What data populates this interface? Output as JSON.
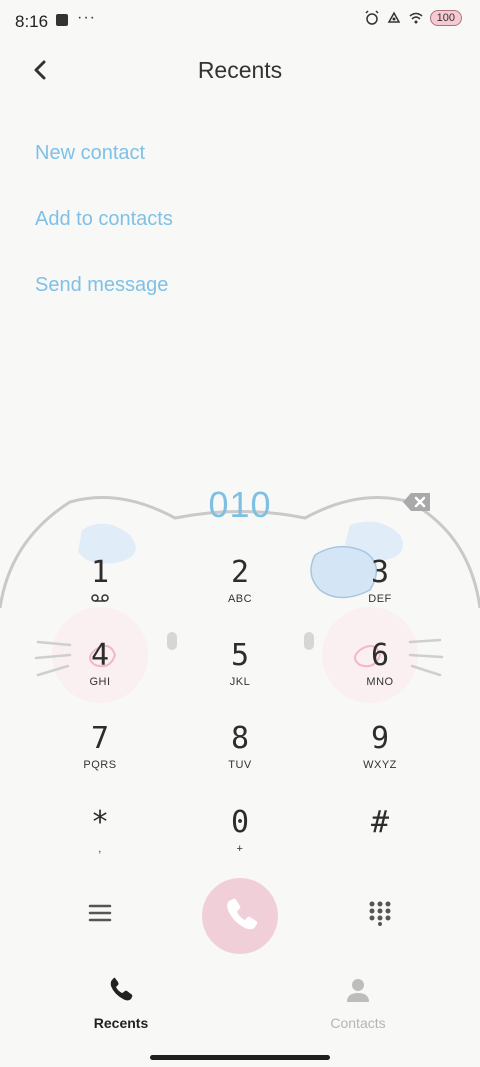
{
  "status_bar": {
    "time": "8:16",
    "overflow": "···",
    "icons": [
      "alarm-icon",
      "settings-icon",
      "wifi-icon"
    ],
    "battery": "100"
  },
  "header": {
    "back_icon": "chevron-left-icon",
    "title": "Recents"
  },
  "menu": {
    "items": [
      {
        "label": "New contact"
      },
      {
        "label": "Add to contacts"
      },
      {
        "label": "Send message"
      }
    ]
  },
  "dialer": {
    "number": "010",
    "keys": [
      {
        "digit": "1",
        "letters": ""
      },
      {
        "digit": "2",
        "letters": "ABC"
      },
      {
        "digit": "3",
        "letters": "DEF"
      },
      {
        "digit": "4",
        "letters": "GHI"
      },
      {
        "digit": "5",
        "letters": "JKL"
      },
      {
        "digit": "6",
        "letters": "MNO"
      },
      {
        "digit": "7",
        "letters": "PQRS"
      },
      {
        "digit": "8",
        "letters": "TUV"
      },
      {
        "digit": "9",
        "letters": "WXYZ"
      },
      {
        "digit": "*",
        "letters": ","
      },
      {
        "digit": "0",
        "letters": "+"
      },
      {
        "digit": "#",
        "letters": ""
      }
    ]
  },
  "bottom_nav": {
    "recents": "Recents",
    "contacts": "Contacts"
  },
  "colors": {
    "accent": "#7fc1e6",
    "call": "#f1cfd8",
    "background": "#f8f8f7"
  }
}
